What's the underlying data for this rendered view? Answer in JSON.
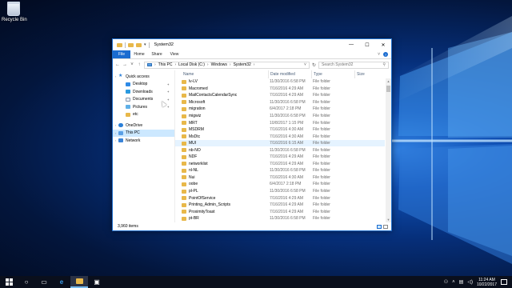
{
  "desktop": {
    "recycle_bin_label": "Recycle Bin"
  },
  "window": {
    "title": "System32",
    "controls": {
      "minimize": "—",
      "maximize": "☐",
      "close": "✕"
    },
    "ribbon": {
      "file": "File",
      "tabs": [
        "Home",
        "Share",
        "View"
      ]
    },
    "address": {
      "crumbs": [
        "This PC",
        "Local Disk (C:)",
        "Windows",
        "System32"
      ]
    },
    "search": {
      "placeholder": "Search System32"
    },
    "nav": [
      {
        "label": "Quick access",
        "icon": "star-icon",
        "indent": 0
      },
      {
        "label": "Desktop",
        "icon": "desktop-icon",
        "indent": 1,
        "pinned": true
      },
      {
        "label": "Downloads",
        "icon": "downloads-icon",
        "indent": 1,
        "pinned": true
      },
      {
        "label": "Documents",
        "icon": "documents-icon",
        "indent": 1,
        "pinned": true
      },
      {
        "label": "Pictures",
        "icon": "pictures-icon",
        "indent": 1,
        "pinned": true
      },
      {
        "label": "etc",
        "icon": "folder-icon",
        "indent": 1,
        "pinned": false
      },
      {
        "label": "OneDrive",
        "icon": "onedrive-icon",
        "indent": 0
      },
      {
        "label": "This PC",
        "icon": "this-pc-icon",
        "indent": 0,
        "selected": true
      },
      {
        "label": "Network",
        "icon": "network-icon",
        "indent": 0
      }
    ],
    "columns": {
      "name": "Name",
      "date": "Date modified",
      "type": "Type",
      "size": "Size"
    },
    "files": [
      {
        "name": "lv-LV",
        "date": "11/30/2016 6:58 PM",
        "type": "File folder"
      },
      {
        "name": "Macromed",
        "date": "7/16/2016 4:29 AM",
        "type": "File folder"
      },
      {
        "name": "MailContactsCalendarSync",
        "date": "7/16/2016 4:29 AM",
        "type": "File folder"
      },
      {
        "name": "Microsoft",
        "date": "11/30/2016 6:58 PM",
        "type": "File folder"
      },
      {
        "name": "migration",
        "date": "6/4/2017 2:18 PM",
        "type": "File folder"
      },
      {
        "name": "migwiz",
        "date": "11/30/2016 6:58 PM",
        "type": "File folder"
      },
      {
        "name": "MRT",
        "date": "10/8/2017 1:15 PM",
        "type": "File folder"
      },
      {
        "name": "MSDRM",
        "date": "7/16/2016 4:30 AM",
        "type": "File folder"
      },
      {
        "name": "MsDtc",
        "date": "7/16/2016 4:30 AM",
        "type": "File folder"
      },
      {
        "name": "MUI",
        "date": "7/16/2016 6:15 AM",
        "type": "File folder",
        "hover": true
      },
      {
        "name": "nb-NO",
        "date": "11/30/2016 6:58 PM",
        "type": "File folder"
      },
      {
        "name": "NDF",
        "date": "7/16/2016 4:29 AM",
        "type": "File folder"
      },
      {
        "name": "networklist",
        "date": "7/16/2016 4:29 AM",
        "type": "File folder"
      },
      {
        "name": "nl-NL",
        "date": "11/30/2016 6:58 PM",
        "type": "File folder"
      },
      {
        "name": "Nui",
        "date": "7/16/2016 4:30 AM",
        "type": "File folder"
      },
      {
        "name": "oobe",
        "date": "6/4/2017 2:18 PM",
        "type": "File folder"
      },
      {
        "name": "pl-PL",
        "date": "11/30/2016 6:58 PM",
        "type": "File folder"
      },
      {
        "name": "PointOfService",
        "date": "7/16/2016 4:29 AM",
        "type": "File folder"
      },
      {
        "name": "Printing_Admin_Scripts",
        "date": "7/16/2016 4:29 AM",
        "type": "File folder"
      },
      {
        "name": "ProximityToast",
        "date": "7/16/2016 4:29 AM",
        "type": "File folder"
      },
      {
        "name": "pt-BR",
        "date": "11/30/2016 6:58 PM",
        "type": "File folder"
      },
      {
        "name": "pt-PT",
        "date": "11/30/2016 6:58 PM",
        "type": "File folder"
      }
    ],
    "status": {
      "item_count": "3,960 items"
    }
  },
  "taskbar": {
    "time": "11:24 AM",
    "date": "10/22/2017"
  },
  "colors": {
    "accent": "#1a6cd0",
    "folder": "#e8b84a",
    "taskbar": "#0a0f1c"
  }
}
